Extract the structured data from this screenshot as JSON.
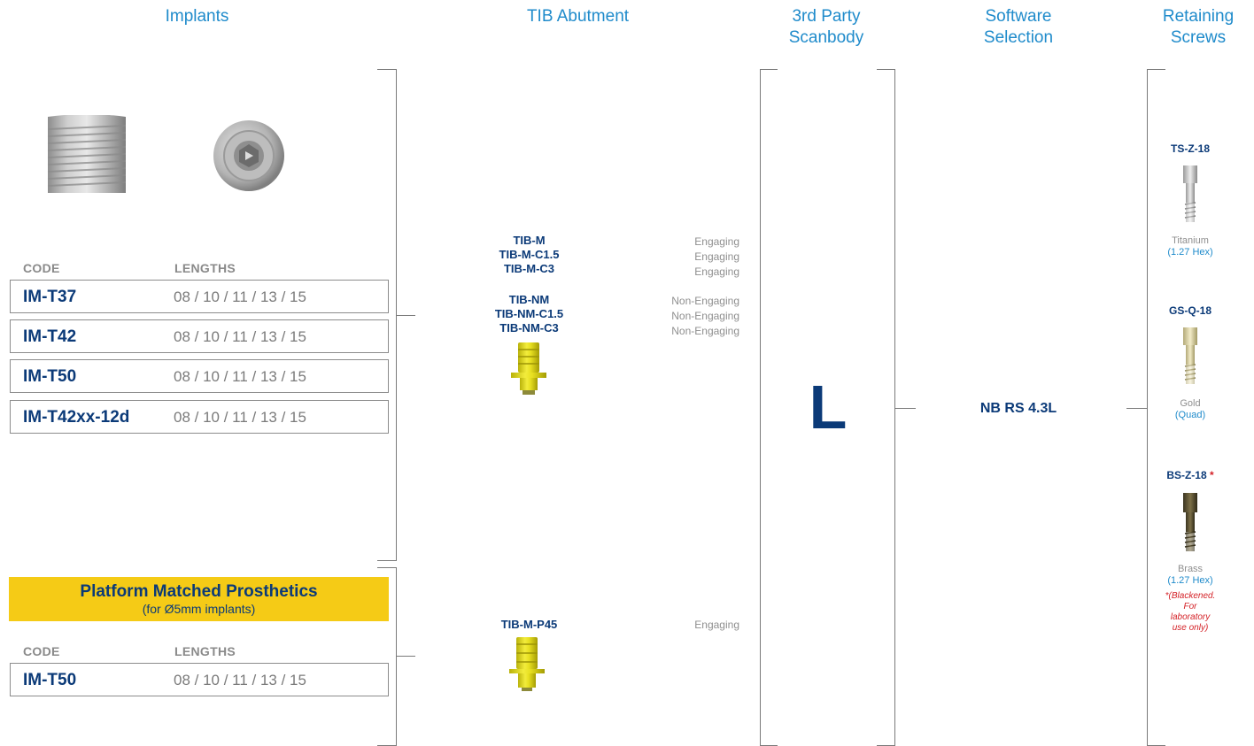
{
  "headers": {
    "implants": "Implants",
    "tib": "TIB Abutment",
    "scanbody_line1": "3rd Party",
    "scanbody_line2": "Scanbody",
    "software_line1": "Software",
    "software_line2": "Selection",
    "screws_line1": "Retaining",
    "screws_line2": "Screws"
  },
  "implants": {
    "code_label": "CODE",
    "lengths_label": "LENGTHS",
    "rows": [
      {
        "code": "IM-T37",
        "lengths": "08 / 10 / 11 / 13 / 15"
      },
      {
        "code": "IM-T42",
        "lengths": "08 / 10 / 11 / 13 / 15"
      },
      {
        "code": "IM-T50",
        "lengths": "08 / 10 / 11 / 13 / 15"
      },
      {
        "code": "IM-T42xx-12d",
        "lengths": "08 / 10 / 11 / 13 / 15"
      }
    ]
  },
  "platform": {
    "title": "Platform Matched Prosthetics",
    "subtitle": "(for Ø5mm implants)",
    "code_label": "CODE",
    "lengths_label": "LENGTHS",
    "rows": [
      {
        "code": "IM-T50",
        "lengths": "08 / 10 / 11 / 13 / 15"
      }
    ]
  },
  "tib": {
    "group1": [
      {
        "code": "TIB-M",
        "type": "Engaging"
      },
      {
        "code": "TIB-M-C1.5",
        "type": "Engaging"
      },
      {
        "code": "TIB-M-C3",
        "type": "Engaging"
      }
    ],
    "group2": [
      {
        "code": "TIB-NM",
        "type": "Non-Engaging"
      },
      {
        "code": "TIB-NM-C1.5",
        "type": "Non-Engaging"
      },
      {
        "code": "TIB-NM-C3",
        "type": "Non-Engaging"
      }
    ],
    "group3": [
      {
        "code": "TIB-M-P45",
        "type": "Engaging"
      }
    ]
  },
  "scanbody": {
    "letter": "L"
  },
  "software": {
    "selection": "NB RS 4.3L"
  },
  "screws": [
    {
      "code": "TS-Z-18",
      "material": "Titanium",
      "drive": "(1.27 Hex)"
    },
    {
      "code": "GS-Q-18",
      "material": "Gold",
      "drive": "(Quad)"
    },
    {
      "code": "BS-Z-18",
      "asterisk": "*",
      "material": "Brass",
      "drive": "(1.27 Hex)",
      "note_line1": "*(Blackened.",
      "note_line2": "For",
      "note_line3": "laboratory",
      "note_line4": "use only)"
    }
  ],
  "colors": {
    "accent_blue": "#1f8bcb",
    "navy": "#0b3a78",
    "banner_yellow": "#f5cb16",
    "note_red": "#d42127",
    "muted_gray": "#8f8f8f"
  }
}
